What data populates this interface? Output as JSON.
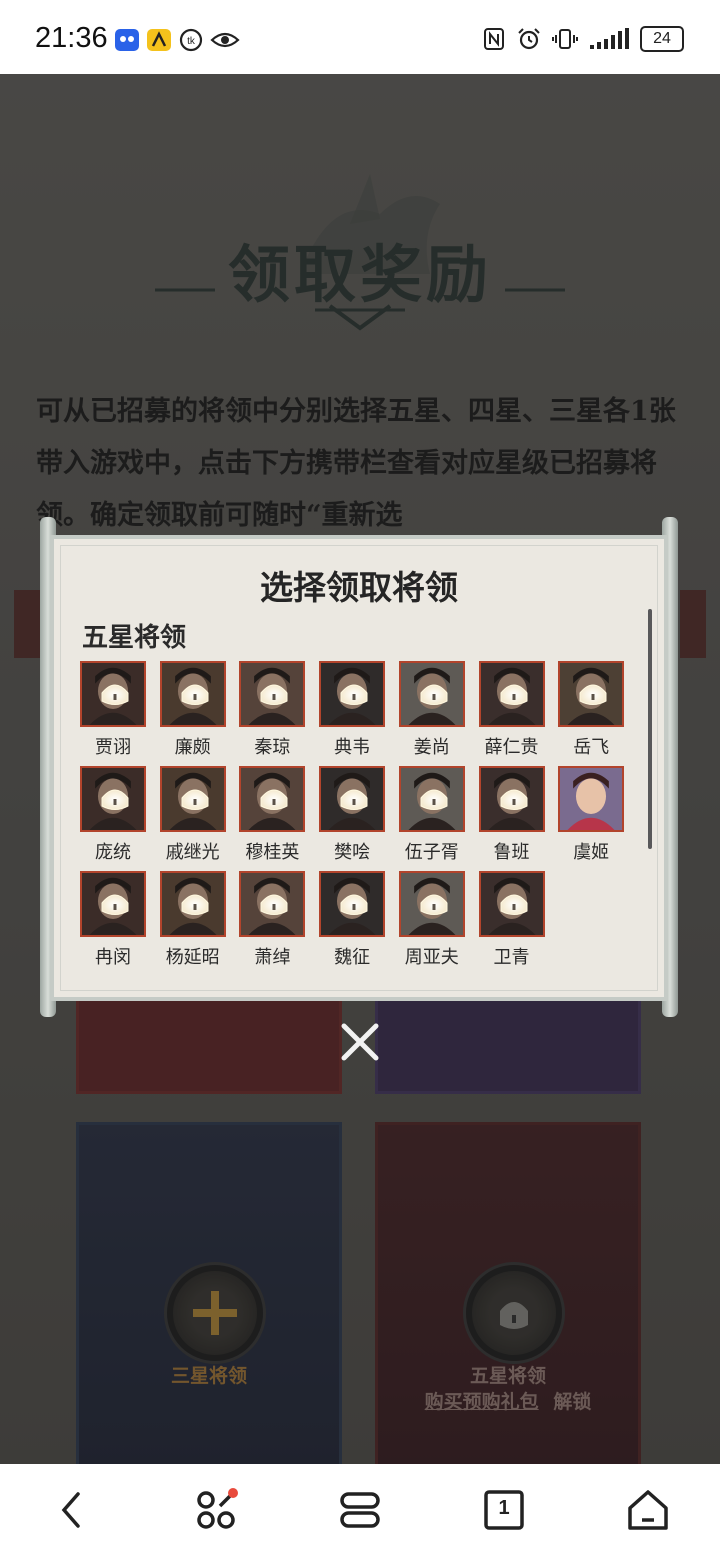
{
  "status_bar": {
    "time": "21:36",
    "battery": "24",
    "left_icons": [
      "app-icon-blue",
      "app-icon-yellow",
      "data-saver-icon",
      "eye-icon"
    ],
    "right_icons": [
      "nfc-icon",
      "alarm-icon",
      "vibrate-icon",
      "signal-icon",
      "battery-icon"
    ]
  },
  "page": {
    "title": "领取奖励",
    "description": "可从已招募的将领中分别选择五星、四星、三星各1张带入游戏中，点击下方携带栏查看对应星级已招募将领。确定领取前可随时“重新选"
  },
  "cards": {
    "left_label": "三星将领",
    "right_label_1": "五星将领",
    "right_label_2": "购买预购礼包",
    "right_label_3": "解锁"
  },
  "modal": {
    "title": "选择领取将领",
    "section": "五星将领",
    "heroes": [
      {
        "name": "贾诩",
        "locked": true
      },
      {
        "name": "廉颇",
        "locked": true
      },
      {
        "name": "秦琼",
        "locked": true
      },
      {
        "name": "典韦",
        "locked": true
      },
      {
        "name": "姜尚",
        "locked": true
      },
      {
        "name": "薛仁贵",
        "locked": true
      },
      {
        "name": "岳飞",
        "locked": true
      },
      {
        "name": "庞统",
        "locked": true
      },
      {
        "name": "戚继光",
        "locked": true
      },
      {
        "name": "穆桂英",
        "locked": true
      },
      {
        "name": "樊哙",
        "locked": true
      },
      {
        "name": "伍子胥",
        "locked": true
      },
      {
        "name": "鲁班",
        "locked": true
      },
      {
        "name": "虞姬",
        "locked": false
      },
      {
        "name": "冉闵",
        "locked": true
      },
      {
        "name": "杨延昭",
        "locked": true
      },
      {
        "name": "萧绰",
        "locked": true
      },
      {
        "name": "魏征",
        "locked": true
      },
      {
        "name": "周亚夫",
        "locked": true
      },
      {
        "name": "卫青",
        "locked": true
      }
    ]
  },
  "navbar": {
    "tab_count": "1",
    "icons": [
      "back-icon",
      "assistant-icon",
      "menu-icon",
      "tabs-icon",
      "home-icon"
    ]
  },
  "colors": {
    "portrait_border": "#b2442c",
    "paper": "#ebe8e1",
    "title_ink": "#2d3a35",
    "gold_accent": "#c9973a"
  }
}
